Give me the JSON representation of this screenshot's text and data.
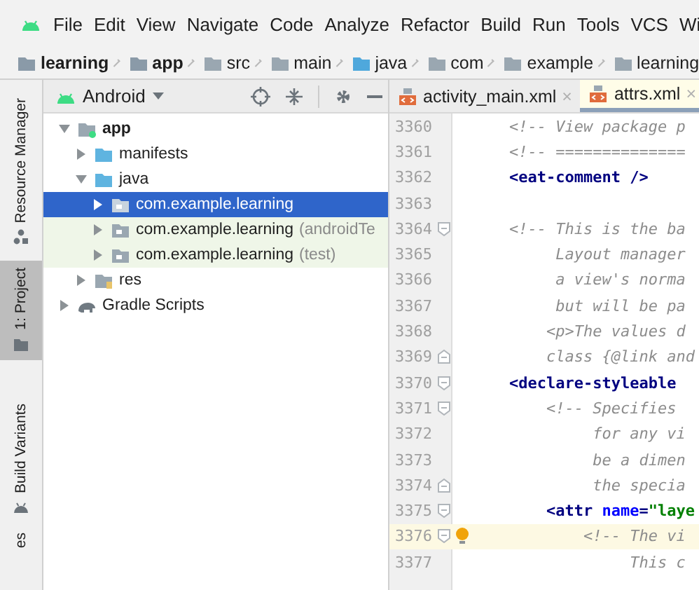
{
  "menu_bar": {
    "items": [
      "File",
      "Edit",
      "View",
      "Navigate",
      "Code",
      "Analyze",
      "Refactor",
      "Build",
      "Run",
      "Tools",
      "VCS",
      "Wi"
    ]
  },
  "breadcrumbs": [
    {
      "label": "learning",
      "kind": "module"
    },
    {
      "label": "app",
      "kind": "module"
    },
    {
      "label": "src",
      "kind": "folder"
    },
    {
      "label": "main",
      "kind": "folder"
    },
    {
      "label": "java",
      "kind": "source"
    },
    {
      "label": "com",
      "kind": "package"
    },
    {
      "label": "example",
      "kind": "package"
    },
    {
      "label": "learning",
      "kind": "package"
    }
  ],
  "tool_stripe": [
    {
      "label": "Resource Manager",
      "kind": "resources",
      "selected": false
    },
    {
      "label": "1: Project",
      "kind": "project",
      "selected": true
    },
    {
      "label": "Build Variants",
      "kind": "variants",
      "selected": false
    },
    {
      "label": "es",
      "kind": "favorites",
      "selected": false
    }
  ],
  "project_panel": {
    "view": "Android",
    "tree": [
      {
        "label": "app",
        "kind": "module",
        "expanded": true,
        "selected": false,
        "children": [
          {
            "label": "manifests",
            "kind": "folder",
            "expanded": false,
            "selected": false
          },
          {
            "label": "java",
            "kind": "folder",
            "expanded": true,
            "selected": false,
            "children": [
              {
                "label": "com.example.learning",
                "kind": "package",
                "expanded": false,
                "selected": true
              },
              {
                "label": "com.example.learning",
                "suffix": "(androidTe",
                "kind": "test-package",
                "expanded": false,
                "selected": false
              },
              {
                "label": "com.example.learning",
                "suffix": "(test)",
                "kind": "test-package",
                "expanded": false,
                "selected": false
              }
            ]
          },
          {
            "label": "res",
            "kind": "resources",
            "expanded": false,
            "selected": false
          }
        ]
      },
      {
        "label": "Gradle Scripts",
        "kind": "gradle",
        "expanded": false,
        "selected": false
      }
    ]
  },
  "editor": {
    "tabs": [
      {
        "label": "activity_main.xml",
        "close": "×",
        "selected": false
      },
      {
        "label": "attrs.xml",
        "close": "×",
        "selected": true
      }
    ],
    "lines": [
      {
        "number": "3360",
        "fold_start": false,
        "fold_end": false,
        "current": false,
        "tokens": [
          {
            "kind": "comment",
            "text": "    <!-- View package p"
          }
        ]
      },
      {
        "number": "3361",
        "fold_start": false,
        "fold_end": false,
        "current": false,
        "tokens": [
          {
            "kind": "comment",
            "text": "    <!-- =============="
          }
        ]
      },
      {
        "number": "3362",
        "fold_start": false,
        "fold_end": false,
        "current": false,
        "tokens": [
          {
            "kind": "tag",
            "text": "    <eat-comment />"
          }
        ]
      },
      {
        "number": "3363",
        "fold_start": false,
        "fold_end": false,
        "current": false
      },
      {
        "number": "3364",
        "fold_start": true,
        "fold_end": false,
        "current": false,
        "tokens": [
          {
            "kind": "comment",
            "text": "    <!-- This is the ba"
          }
        ]
      },
      {
        "number": "3365",
        "fold_start": false,
        "fold_end": false,
        "current": false,
        "tokens": [
          {
            "kind": "comment",
            "text": "         Layout manager"
          }
        ]
      },
      {
        "number": "3366",
        "fold_start": false,
        "fold_end": false,
        "current": false,
        "tokens": [
          {
            "kind": "comment",
            "text": "         a view's norma"
          }
        ]
      },
      {
        "number": "3367",
        "fold_start": false,
        "fold_end": false,
        "current": false,
        "tokens": [
          {
            "kind": "comment",
            "text": "         but will be pa"
          }
        ]
      },
      {
        "number": "3368",
        "fold_start": false,
        "fold_end": false,
        "current": false,
        "tokens": [
          {
            "kind": "comment",
            "text": "        <p>The values d"
          }
        ]
      },
      {
        "number": "3369",
        "fold_start": false,
        "fold_end": true,
        "current": false,
        "tokens": [
          {
            "kind": "comment",
            "text": "        class {@link and"
          }
        ]
      },
      {
        "number": "3370",
        "fold_start": true,
        "fold_end": false,
        "current": false,
        "tokens": [
          {
            "kind": "tag",
            "text": "    <declare-styleable "
          }
        ]
      },
      {
        "number": "3371",
        "fold_start": true,
        "fold_end": false,
        "current": false,
        "tokens": [
          {
            "kind": "comment",
            "text": "        <!-- Specifies "
          }
        ]
      },
      {
        "number": "3372",
        "fold_start": false,
        "fold_end": false,
        "current": false,
        "tokens": [
          {
            "kind": "comment",
            "text": "             for any vi"
          }
        ]
      },
      {
        "number": "3373",
        "fold_start": false,
        "fold_end": false,
        "current": false,
        "tokens": [
          {
            "kind": "comment",
            "text": "             be a dimen"
          }
        ]
      },
      {
        "number": "3374",
        "fold_start": false,
        "fold_end": true,
        "current": false,
        "tokens": [
          {
            "kind": "comment",
            "text": "             the specia"
          }
        ]
      },
      {
        "number": "3375",
        "fold_start": true,
        "fold_end": false,
        "current": false,
        "tokens": [
          {
            "kind": "tag",
            "text": "        <attr "
          },
          {
            "kind": "attr",
            "text": "name"
          },
          {
            "kind": "tag",
            "text": "="
          },
          {
            "kind": "value",
            "text": "\"laye"
          }
        ]
      },
      {
        "number": "3376",
        "fold_start": true,
        "fold_end": false,
        "current": true,
        "tokens": [
          {
            "kind": "comment",
            "text": "            <!-- The vi"
          }
        ]
      },
      {
        "number": "3377",
        "fold_start": false,
        "fold_end": false,
        "current": false,
        "tokens": [
          {
            "kind": "comment",
            "text": "                 This c"
          }
        ]
      }
    ]
  }
}
